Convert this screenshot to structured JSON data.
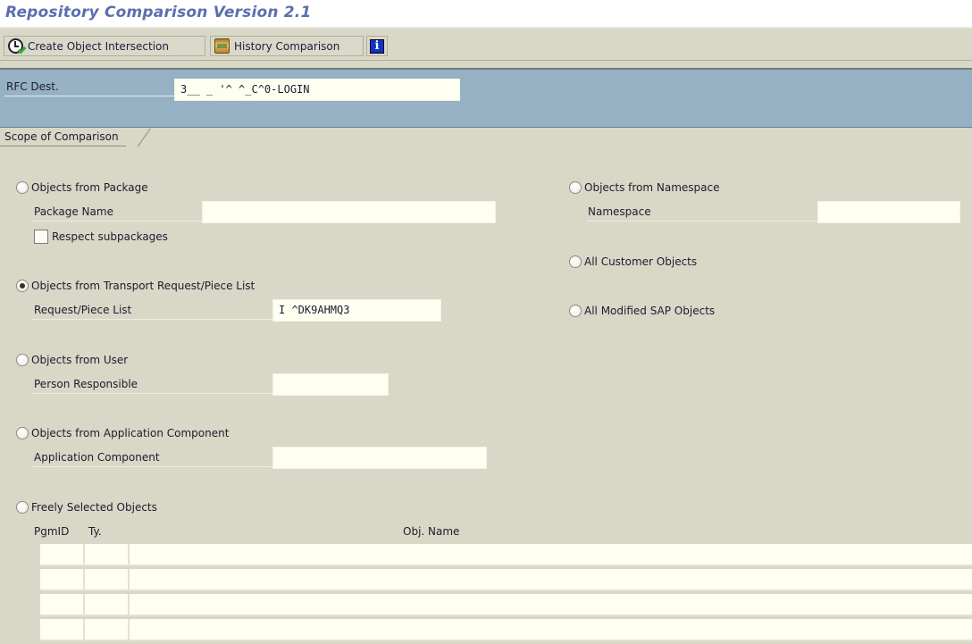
{
  "window": {
    "title": "Repository Comparison Version 2.1"
  },
  "toolbar": {
    "buttons": [
      {
        "label": "Create Object Intersection",
        "icon": "clock-check-icon"
      },
      {
        "label": "History Comparison",
        "icon": "scroll-icon"
      }
    ],
    "info_label": "i"
  },
  "header": {
    "rfc_dest": {
      "label": "RFC Dest.",
      "value": "3__ _ '^ ^_C^0-LOGIN"
    }
  },
  "tab": {
    "label": "Scope of Comparison"
  },
  "scope": {
    "left": [
      {
        "option": "Objects from Package",
        "selected": false,
        "field": {
          "label": "Package Name",
          "value": ""
        },
        "checkbox": {
          "label": "Respect subpackages",
          "checked": false
        }
      },
      {
        "option": "Objects from Transport Request/Piece List",
        "selected": true,
        "field": {
          "label": "Request/Piece List",
          "value": "I ^DK9AHMQ3"
        }
      },
      {
        "option": "Objects from User",
        "selected": false,
        "field": {
          "label": "Person Responsible",
          "value": ""
        }
      },
      {
        "option": "Objects from Application Component",
        "selected": false,
        "field": {
          "label": "Application Component",
          "value": ""
        }
      },
      {
        "option": "Freely Selected Objects",
        "selected": false
      }
    ],
    "right": [
      {
        "option": "Objects from Namespace",
        "selected": false,
        "field": {
          "label": "Namespace",
          "value": ""
        }
      },
      {
        "option": "All Customer Objects",
        "selected": false
      },
      {
        "option": "All Modified SAP Objects",
        "selected": false
      }
    ]
  },
  "objects_table": {
    "columns": [
      "PgmID",
      "Ty.",
      "Obj. Name"
    ],
    "rows": [
      [
        "",
        "",
        ""
      ],
      [
        "",
        "",
        ""
      ],
      [
        "",
        "",
        ""
      ],
      [
        "",
        "",
        ""
      ]
    ]
  }
}
